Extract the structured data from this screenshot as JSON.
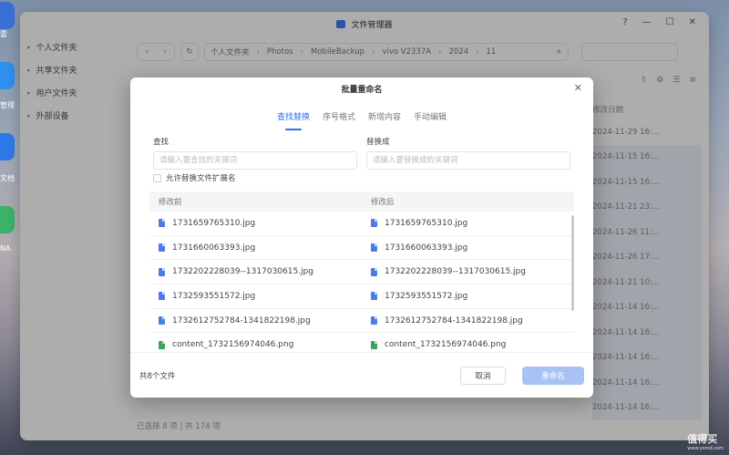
{
  "desktop": {
    "dock_labels": [
      "雷",
      "管理",
      "文档",
      "NA"
    ]
  },
  "window": {
    "title": "文件管理器",
    "controls": {
      "help": "?",
      "minimize": "—",
      "maximize": "☐",
      "close": "✕"
    }
  },
  "sidebar": {
    "items": [
      {
        "label": "个人文件夹"
      },
      {
        "label": "共享文件夹"
      },
      {
        "label": "用户文件夹"
      },
      {
        "label": "外部设备"
      }
    ]
  },
  "toolbar": {
    "path": [
      "个人文件夹",
      "Photos",
      "MobileBackup",
      "vivo V2337A",
      "2024",
      "11"
    ]
  },
  "file_list": {
    "date_header": "修改日期",
    "dates": [
      {
        "value": "2024-11-29 16:...",
        "selected": false
      },
      {
        "value": "2024-11-15 16:...",
        "selected": true
      },
      {
        "value": "2024-11-15 16:...",
        "selected": true
      },
      {
        "value": "2024-11-21 23:...",
        "selected": true
      },
      {
        "value": "2024-11-26 11:...",
        "selected": true
      },
      {
        "value": "2024-11-26 17:...",
        "selected": true
      },
      {
        "value": "2024-11-21 10:...",
        "selected": true
      },
      {
        "value": "2024-11-14 16:...",
        "selected": true
      },
      {
        "value": "2024-11-14 16:...",
        "selected": true
      },
      {
        "value": "2024-11-14 16:...",
        "selected": true
      },
      {
        "value": "2024-11-14 16:...",
        "selected": true
      },
      {
        "value": "2024-11-14 16:...",
        "selected": true
      }
    ],
    "status": "已选择 8 项 | 共 174 项"
  },
  "dialog": {
    "title": "批量重命名",
    "close": "✕",
    "tabs": [
      {
        "label": "查找替换",
        "active": true
      },
      {
        "label": "序号格式",
        "active": false
      },
      {
        "label": "新增内容",
        "active": false
      },
      {
        "label": "手动编辑",
        "active": false
      }
    ],
    "find": {
      "label": "查找",
      "placeholder": "请输入要查找的关键词",
      "value": ""
    },
    "replace": {
      "label": "替换成",
      "placeholder": "请输入要替换成的关键词",
      "value": ""
    },
    "allow_ext": {
      "label": "允许替换文件扩展名",
      "checked": false
    },
    "table": {
      "headers": [
        "修改前",
        "修改后"
      ],
      "rows": [
        {
          "before": "1731659765310.jpg",
          "after": "1731659765310.jpg",
          "type": "jpg"
        },
        {
          "before": "1731660063393.jpg",
          "after": "1731660063393.jpg",
          "type": "jpg"
        },
        {
          "before": "1732202228039--1317030615.jpg",
          "after": "1732202228039--1317030615.jpg",
          "type": "jpg"
        },
        {
          "before": "1732593551572.jpg",
          "after": "1732593551572.jpg",
          "type": "jpg"
        },
        {
          "before": "1732612752784-1341822198.jpg",
          "after": "1732612752784-1341822198.jpg",
          "type": "jpg"
        },
        {
          "before": "content_1732156974046.png",
          "after": "content_1732156974046.png",
          "type": "png"
        }
      ]
    },
    "count": "共8个文件",
    "cancel_label": "取消",
    "confirm_label": "重命名"
  },
  "watermark": {
    "text": "值得买",
    "sub": "www.yomd.com"
  }
}
